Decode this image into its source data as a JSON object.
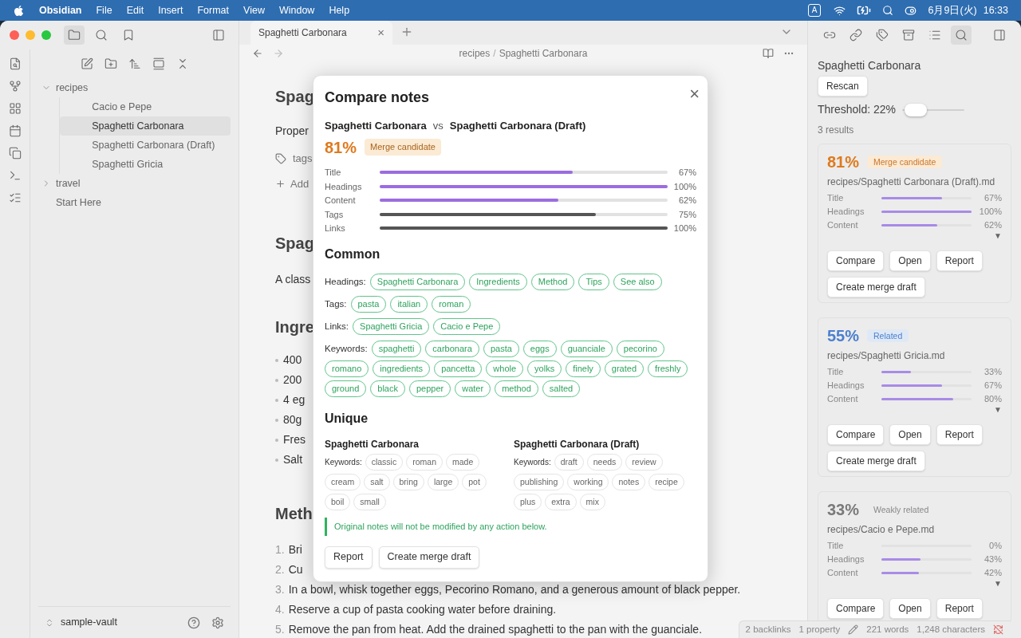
{
  "menu_bar": {
    "app": "Obsidian",
    "items": [
      "File",
      "Edit",
      "Insert",
      "Format",
      "View",
      "Window",
      "Help"
    ],
    "input_badge": "A",
    "date": "6月9日(火)",
    "time": "16:33"
  },
  "left_tools": [
    {
      "selected": true
    },
    {
      "selected": false
    },
    {
      "selected": false
    }
  ],
  "right_tools": [
    {
      "selected": false
    },
    {
      "selected": false
    },
    {
      "selected": false
    },
    {
      "selected": false
    },
    {
      "selected": false
    },
    {
      "selected": true
    }
  ],
  "tab": {
    "title": "Spaghetti Carbonara",
    "close": "×"
  },
  "file_tree": [
    {
      "label": "recipes",
      "expanded": true,
      "selected": false,
      "children": [
        {
          "label": "Cacio e Pepe",
          "selected": false
        },
        {
          "label": "Spaghetti Carbonara",
          "selected": true
        },
        {
          "label": "Spaghetti Carbonara (Draft)",
          "selected": false
        },
        {
          "label": "Spaghetti Gricia",
          "selected": false
        }
      ]
    },
    {
      "label": "travel",
      "expanded": false,
      "selected": false
    },
    {
      "label": "Start Here",
      "selected": false
    }
  ],
  "vault": "sample-vault",
  "breadcrumb": {
    "folder": "recipes",
    "separator": "/",
    "note": "Spaghetti Carbonara"
  },
  "editor": {
    "title": "Spag",
    "properties_label": "Proper",
    "tags_label": "tags",
    "add_label": "Add",
    "heading": "Spag",
    "intro": "A class",
    "ingredients_heading": "Ingre",
    "ingredients": [
      "400",
      "200",
      "4 eg",
      "80g",
      "Fres",
      "Salt"
    ],
    "method_heading": "Meth",
    "method_steps": [
      {
        "number": "1.",
        "text": "Bri"
      },
      {
        "number": "2.",
        "text": "Cu"
      },
      {
        "number": "3.",
        "text": "In a bowl, whisk together eggs, Pecorino Romano, and a generous amount of black pepper."
      },
      {
        "number": "4.",
        "text": "Reserve a cup of pasta cooking water before draining."
      },
      {
        "number": "5.",
        "text": "Remove the pan from heat. Add the drained spaghetti to the pan with the guanciale."
      }
    ]
  },
  "modal": {
    "title": "Compare notes",
    "close": "×",
    "note_a": "Spaghetti Carbonara",
    "vs": "vs",
    "note_b": "Spaghetti Carbonara (Draft)",
    "score": "81%",
    "badge": "Merge candidate",
    "metrics": [
      {
        "label": "Title",
        "level": 0.67,
        "value": "67%",
        "color": "#9b6de0"
      },
      {
        "label": "Headings",
        "level": 1.0,
        "value": "100%",
        "color": "#9b6de0"
      },
      {
        "label": "Content",
        "level": 0.62,
        "value": "62%",
        "color": "#9b6de0"
      },
      {
        "label": "Tags",
        "level": 0.75,
        "value": "75%",
        "color": "#555555"
      },
      {
        "label": "Links",
        "level": 1.0,
        "value": "100%",
        "color": "#555555"
      }
    ],
    "common_heading": "Common",
    "common": [
      {
        "label": "Headings:",
        "chips": [
          "Spaghetti Carbonara",
          "Ingredients",
          "Method",
          "Tips",
          "See also"
        ]
      },
      {
        "label": "Tags:",
        "chips": [
          "pasta",
          "italian",
          "roman"
        ]
      },
      {
        "label": "Links:",
        "chips": [
          "Spaghetti Gricia",
          "Cacio e Pepe"
        ]
      },
      {
        "label": "Keywords:",
        "chips": [
          "spaghetti",
          "carbonara",
          "pasta",
          "eggs",
          "guanciale",
          "pecorino",
          "romano",
          "ingredients",
          "pancetta",
          "whole",
          "yolks",
          "finely",
          "grated",
          "freshly",
          "ground",
          "black",
          "pepper",
          "water",
          "method",
          "salted"
        ]
      }
    ],
    "unique_heading": "Unique",
    "unique": [
      {
        "title": "Spaghetti Carbonara",
        "label": "Keywords:",
        "chips": [
          "classic",
          "roman",
          "made",
          "cream",
          "salt",
          "bring",
          "large",
          "pot",
          "boil",
          "small"
        ]
      },
      {
        "title": "Spaghetti Carbonara (Draft)",
        "label": "Keywords:",
        "chips": [
          "draft",
          "needs",
          "review",
          "publishing",
          "working",
          "notes",
          "recipe",
          "plus",
          "extra",
          "mix"
        ]
      }
    ],
    "note": "Original notes will not be modified by any action below.",
    "buttons": [
      "Report",
      "Create merge draft"
    ]
  },
  "right_panel": {
    "note": "Spaghetti Carbonara",
    "rescan": "Rescan",
    "threshold_label": "Threshold: 22%",
    "threshold": {
      "level": 0.22
    },
    "result_count": "3 results",
    "results": [
      {
        "kind": "merge",
        "score": "81%",
        "badge": "Merge candidate",
        "path": "recipes/Spaghetti Carbonara (Draft).md",
        "toggle": "▼",
        "metrics": [
          {
            "label": "Title",
            "level": 0.67,
            "value": "67%"
          },
          {
            "label": "Headings",
            "level": 1.0,
            "value": "100%"
          },
          {
            "label": "Content",
            "level": 0.62,
            "value": "62%"
          }
        ],
        "buttons": [
          "Compare",
          "Open",
          "Report",
          "Create merge draft"
        ]
      },
      {
        "kind": "related",
        "score": "55%",
        "badge": "Related",
        "path": "recipes/Spaghetti Gricia.md",
        "toggle": "▼",
        "metrics": [
          {
            "label": "Title",
            "level": 0.33,
            "value": "33%"
          },
          {
            "label": "Headings",
            "level": 0.67,
            "value": "67%"
          },
          {
            "label": "Content",
            "level": 0.8,
            "value": "80%"
          }
        ],
        "buttons": [
          "Compare",
          "Open",
          "Report",
          "Create merge draft"
        ]
      },
      {
        "kind": "weak",
        "score": "33%",
        "badge": "Weakly related",
        "path": "recipes/Cacio e Pepe.md",
        "toggle": "▼",
        "metrics": [
          {
            "label": "Title",
            "level": 0.0,
            "value": "0%"
          },
          {
            "label": "Headings",
            "level": 0.43,
            "value": "43%"
          },
          {
            "label": "Content",
            "level": 0.42,
            "value": "42%"
          }
        ],
        "buttons": [
          "Compare",
          "Open",
          "Report"
        ]
      }
    ]
  },
  "status_bar": {
    "backlinks": "2 backlinks",
    "properties": "1 property",
    "words": "221 words",
    "characters": "1,248 characters"
  }
}
